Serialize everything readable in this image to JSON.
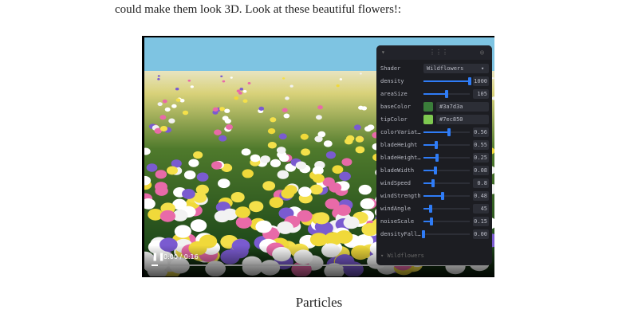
{
  "intro": "could make them look 3D. Look at these beautiful flowers!:",
  "video": {
    "time": "0:00 / 0:16",
    "progress": 0.02
  },
  "panel": {
    "shader_label": "Shader",
    "shader_value": "Wildflowers",
    "rows": [
      {
        "label": "density",
        "type": "slider",
        "value": "1000",
        "fraction": 1.0
      },
      {
        "label": "areaSize",
        "type": "slider",
        "value": "105",
        "fraction": 0.5
      },
      {
        "label": "baseColor",
        "type": "color",
        "value": "#3a7d3a"
      },
      {
        "label": "tipColor",
        "type": "color",
        "value": "#7ec850"
      },
      {
        "label": "colorVariat…",
        "type": "slider",
        "value": "0.56",
        "fraction": 0.56
      },
      {
        "label": "bladeHeight",
        "type": "slider",
        "value": "0.55",
        "fraction": 0.27
      },
      {
        "label": "bladeHeight…",
        "type": "slider",
        "value": "0.25",
        "fraction": 0.3
      },
      {
        "label": "bladeWidth",
        "type": "slider",
        "value": "0.08",
        "fraction": 0.25
      },
      {
        "label": "windSpeed",
        "type": "slider",
        "value": "0.8",
        "fraction": 0.2
      },
      {
        "label": "windStrength",
        "type": "slider",
        "value": "0.48",
        "fraction": 0.42
      },
      {
        "label": "windAngle",
        "type": "slider",
        "value": "45",
        "fraction": 0.16
      },
      {
        "label": "noiseScale",
        "type": "slider",
        "value": "0.15",
        "fraction": 0.18
      },
      {
        "label": "densityFall…",
        "type": "slider",
        "value": "0.00",
        "fraction": 0.0
      }
    ],
    "folder": "Wildflowers"
  },
  "section_title": "Particles"
}
